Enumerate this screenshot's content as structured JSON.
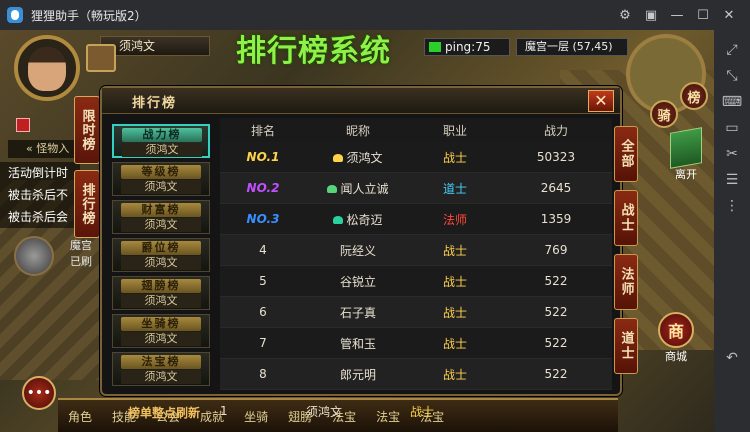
{
  "window": {
    "title": "狸狸助手（畅玩版2）",
    "controls": [
      "gear-icon",
      "gift-icon",
      "minimize-icon",
      "maximize-icon",
      "close-icon"
    ]
  },
  "sidebar": {
    "icons": [
      "fullscreen-icon",
      "shrink-icon",
      "keyboard-icon",
      "screen-icon",
      "scissors-icon",
      "volume-icon",
      "more-icon",
      "back-icon"
    ]
  },
  "hud": {
    "player_name": "须鸿文",
    "banner": "排行榜系统",
    "ping": "ping:75",
    "map": "魔宫一层 (57,45)",
    "mount_btn": "骑",
    "rank_btn": "榜",
    "leave": "离开",
    "shop_icon": "商",
    "shop": "商城",
    "left_tabs": [
      "限时榜",
      "排行榜"
    ],
    "left_items": [
      "活动倒计时",
      "被击杀后不",
      "被击杀后会"
    ],
    "chevron_label": "怪物入",
    "orb_text": [
      "魔宫",
      "已刷"
    ],
    "bottom_bar": [
      "角色",
      "技能",
      "公会",
      "成就",
      "坐骑",
      "翅膀",
      "法宝",
      "法宝",
      "法宝"
    ],
    "chat": "•••"
  },
  "panel": {
    "title": "排行榜",
    "close": "✕",
    "categories": [
      {
        "label": "战力榜",
        "sub": "须鸿文",
        "active": true
      },
      {
        "label": "等级榜",
        "sub": "须鸿文",
        "active": false
      },
      {
        "label": "财富榜",
        "sub": "须鸿文",
        "active": false
      },
      {
        "label": "爵位榜",
        "sub": "须鸿文",
        "active": false
      },
      {
        "label": "翅膀榜",
        "sub": "须鸿文",
        "active": false
      },
      {
        "label": "坐骑榜",
        "sub": "须鸿文",
        "active": false
      },
      {
        "label": "法宝榜",
        "sub": "须鸿文",
        "active": false
      }
    ],
    "headers": [
      "排名",
      "昵称",
      "职业",
      "战力"
    ],
    "rows": [
      {
        "rank": "NO.1",
        "name": "须鸿文",
        "class": "战士",
        "power": "50323",
        "rank_color": "#ffd24a",
        "class_color": "#ffd24a",
        "lead_color": "#ffd24a"
      },
      {
        "rank": "NO.2",
        "name": "闻人立诚",
        "class": "道士",
        "power": "2645",
        "rank_color": "#c050ff",
        "class_color": "#46d0ff",
        "lead_color": "#57d37a"
      },
      {
        "rank": "NO.3",
        "name": "松奇迈",
        "class": "法师",
        "power": "1359",
        "rank_color": "#3a8fff",
        "class_color": "#ff4a3a",
        "lead_color": "#2ad0a0"
      },
      {
        "rank": "4",
        "name": "阮经义",
        "class": "战士",
        "power": "769",
        "rank_color": "#e8e0d0",
        "class_color": "#ffd24a",
        "lead_color": ""
      },
      {
        "rank": "5",
        "name": "谷锐立",
        "class": "战士",
        "power": "522",
        "rank_color": "#e8e0d0",
        "class_color": "#ffd24a",
        "lead_color": ""
      },
      {
        "rank": "6",
        "name": "石子真",
        "class": "战士",
        "power": "522",
        "rank_color": "#e8e0d0",
        "class_color": "#ffd24a",
        "lead_color": ""
      },
      {
        "rank": "7",
        "name": "管和玉",
        "class": "战士",
        "power": "522",
        "rank_color": "#e8e0d0",
        "class_color": "#ffd24a",
        "lead_color": ""
      },
      {
        "rank": "8",
        "name": "郎元明",
        "class": "战士",
        "power": "522",
        "rank_color": "#e8e0d0",
        "class_color": "#ffd24a",
        "lead_color": ""
      }
    ],
    "class_tabs": [
      "全部",
      "战士",
      "法师",
      "道士"
    ],
    "footer_note": "榜单整点刷新",
    "self_row": {
      "rank": "1",
      "name": "须鸿文",
      "class": "战士",
      "class_color": "#ffd24a"
    }
  }
}
